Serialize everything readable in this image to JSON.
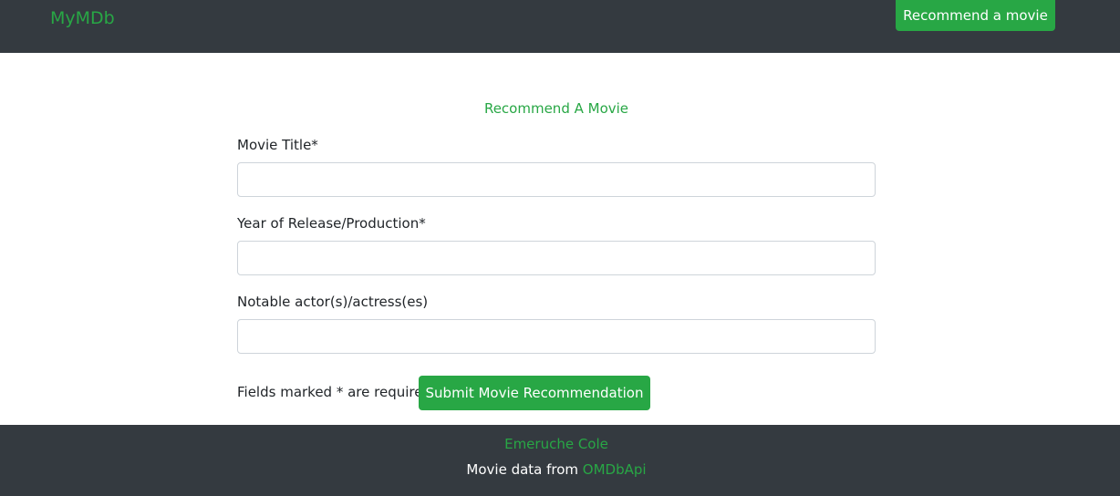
{
  "navbar": {
    "brand": "MyMDb",
    "recommend_button": "Recommend a movie"
  },
  "form": {
    "title": "Recommend A Movie",
    "fields": [
      {
        "label": "Movie Title*",
        "value": "",
        "placeholder": ""
      },
      {
        "label": "Year of Release/Production*",
        "value": "",
        "placeholder": ""
      },
      {
        "label": "Notable actor(s)/actress(es)",
        "value": "",
        "placeholder": ""
      }
    ],
    "required_note": "Fields marked * are required",
    "submit_button": "Submit Movie Recommendation"
  },
  "footer": {
    "author": "Emeruche Cole",
    "credit_text": "Movie data from ",
    "credit_link": "OMDbApi"
  },
  "colors": {
    "accent": "#28a745",
    "navbar_bg": "#343a40",
    "footer_bg": "#343a40"
  }
}
